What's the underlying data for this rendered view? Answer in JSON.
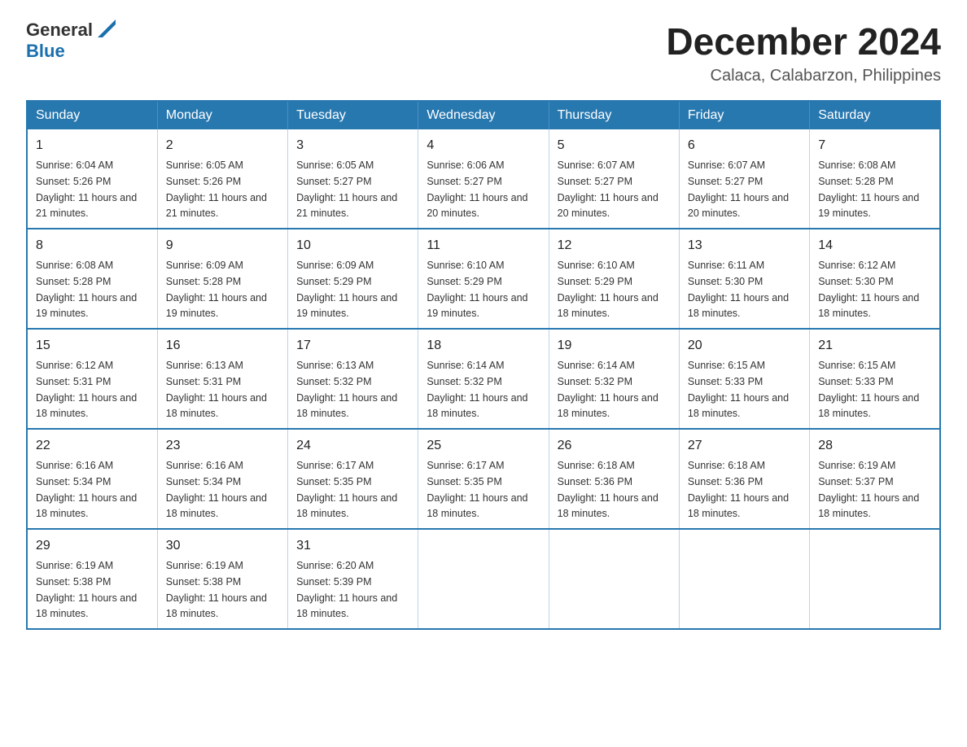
{
  "logo": {
    "general": "General",
    "blue": "Blue"
  },
  "title": "December 2024",
  "subtitle": "Calaca, Calabarzon, Philippines",
  "days_of_week": [
    "Sunday",
    "Monday",
    "Tuesday",
    "Wednesday",
    "Thursday",
    "Friday",
    "Saturday"
  ],
  "weeks": [
    [
      {
        "day": "1",
        "sunrise": "6:04 AM",
        "sunset": "5:26 PM",
        "daylight": "11 hours and 21 minutes."
      },
      {
        "day": "2",
        "sunrise": "6:05 AM",
        "sunset": "5:26 PM",
        "daylight": "11 hours and 21 minutes."
      },
      {
        "day": "3",
        "sunrise": "6:05 AM",
        "sunset": "5:27 PM",
        "daylight": "11 hours and 21 minutes."
      },
      {
        "day": "4",
        "sunrise": "6:06 AM",
        "sunset": "5:27 PM",
        "daylight": "11 hours and 20 minutes."
      },
      {
        "day": "5",
        "sunrise": "6:07 AM",
        "sunset": "5:27 PM",
        "daylight": "11 hours and 20 minutes."
      },
      {
        "day": "6",
        "sunrise": "6:07 AM",
        "sunset": "5:27 PM",
        "daylight": "11 hours and 20 minutes."
      },
      {
        "day": "7",
        "sunrise": "6:08 AM",
        "sunset": "5:28 PM",
        "daylight": "11 hours and 19 minutes."
      }
    ],
    [
      {
        "day": "8",
        "sunrise": "6:08 AM",
        "sunset": "5:28 PM",
        "daylight": "11 hours and 19 minutes."
      },
      {
        "day": "9",
        "sunrise": "6:09 AM",
        "sunset": "5:28 PM",
        "daylight": "11 hours and 19 minutes."
      },
      {
        "day": "10",
        "sunrise": "6:09 AM",
        "sunset": "5:29 PM",
        "daylight": "11 hours and 19 minutes."
      },
      {
        "day": "11",
        "sunrise": "6:10 AM",
        "sunset": "5:29 PM",
        "daylight": "11 hours and 19 minutes."
      },
      {
        "day": "12",
        "sunrise": "6:10 AM",
        "sunset": "5:29 PM",
        "daylight": "11 hours and 18 minutes."
      },
      {
        "day": "13",
        "sunrise": "6:11 AM",
        "sunset": "5:30 PM",
        "daylight": "11 hours and 18 minutes."
      },
      {
        "day": "14",
        "sunrise": "6:12 AM",
        "sunset": "5:30 PM",
        "daylight": "11 hours and 18 minutes."
      }
    ],
    [
      {
        "day": "15",
        "sunrise": "6:12 AM",
        "sunset": "5:31 PM",
        "daylight": "11 hours and 18 minutes."
      },
      {
        "day": "16",
        "sunrise": "6:13 AM",
        "sunset": "5:31 PM",
        "daylight": "11 hours and 18 minutes."
      },
      {
        "day": "17",
        "sunrise": "6:13 AM",
        "sunset": "5:32 PM",
        "daylight": "11 hours and 18 minutes."
      },
      {
        "day": "18",
        "sunrise": "6:14 AM",
        "sunset": "5:32 PM",
        "daylight": "11 hours and 18 minutes."
      },
      {
        "day": "19",
        "sunrise": "6:14 AM",
        "sunset": "5:32 PM",
        "daylight": "11 hours and 18 minutes."
      },
      {
        "day": "20",
        "sunrise": "6:15 AM",
        "sunset": "5:33 PM",
        "daylight": "11 hours and 18 minutes."
      },
      {
        "day": "21",
        "sunrise": "6:15 AM",
        "sunset": "5:33 PM",
        "daylight": "11 hours and 18 minutes."
      }
    ],
    [
      {
        "day": "22",
        "sunrise": "6:16 AM",
        "sunset": "5:34 PM",
        "daylight": "11 hours and 18 minutes."
      },
      {
        "day": "23",
        "sunrise": "6:16 AM",
        "sunset": "5:34 PM",
        "daylight": "11 hours and 18 minutes."
      },
      {
        "day": "24",
        "sunrise": "6:17 AM",
        "sunset": "5:35 PM",
        "daylight": "11 hours and 18 minutes."
      },
      {
        "day": "25",
        "sunrise": "6:17 AM",
        "sunset": "5:35 PM",
        "daylight": "11 hours and 18 minutes."
      },
      {
        "day": "26",
        "sunrise": "6:18 AM",
        "sunset": "5:36 PM",
        "daylight": "11 hours and 18 minutes."
      },
      {
        "day": "27",
        "sunrise": "6:18 AM",
        "sunset": "5:36 PM",
        "daylight": "11 hours and 18 minutes."
      },
      {
        "day": "28",
        "sunrise": "6:19 AM",
        "sunset": "5:37 PM",
        "daylight": "11 hours and 18 minutes."
      }
    ],
    [
      {
        "day": "29",
        "sunrise": "6:19 AM",
        "sunset": "5:38 PM",
        "daylight": "11 hours and 18 minutes."
      },
      {
        "day": "30",
        "sunrise": "6:19 AM",
        "sunset": "5:38 PM",
        "daylight": "11 hours and 18 minutes."
      },
      {
        "day": "31",
        "sunrise": "6:20 AM",
        "sunset": "5:39 PM",
        "daylight": "11 hours and 18 minutes."
      },
      null,
      null,
      null,
      null
    ]
  ]
}
